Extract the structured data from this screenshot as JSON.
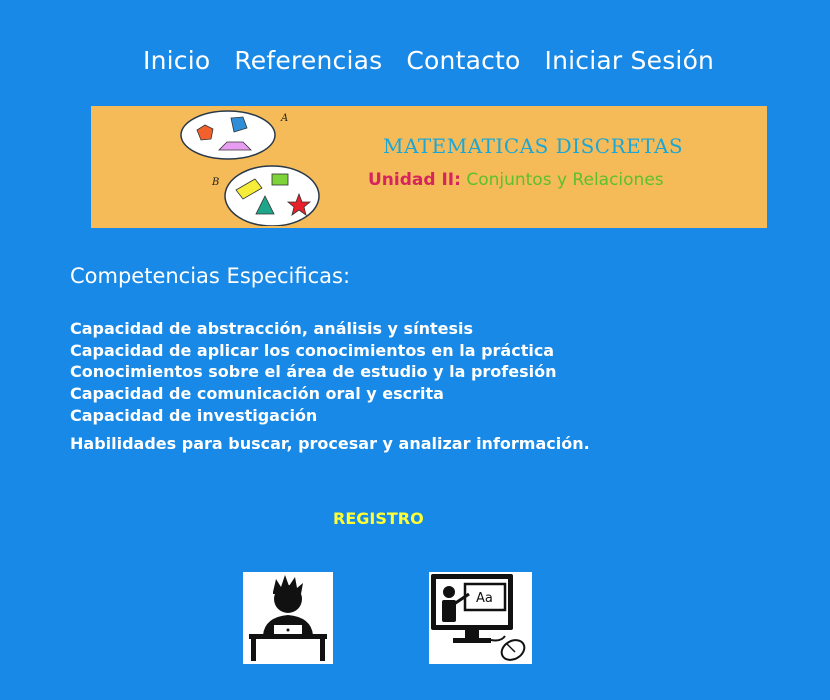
{
  "nav": {
    "items": [
      "Inicio",
      "Referencias",
      "Contacto",
      "Iniciar Sesión"
    ]
  },
  "banner": {
    "title": "MATEMATICAS DISCRETAS",
    "unit": "Unidad II:",
    "topic": "Conjuntos y Relaciones",
    "set_a_label": "A",
    "set_b_label": "B"
  },
  "competencias": {
    "heading": "Competencias Especificas:",
    "items": [
      "Capacidad de abstracción, análisis y síntesis",
      "Capacidad de aplicar los conocimientos en la práctica",
      "Conocimientos sobre el área de estudio y la profesión",
      "Capacidad de comunicación oral y escrita",
      "Capacidad de investigación",
      "Habilidades para buscar, procesar y analizar información."
    ]
  },
  "registro": {
    "label": "REGISTRO",
    "student_icon": "student-laptop-icon",
    "teacher_icon": "teacher-screen-icon",
    "screen_text": "Aa"
  },
  "colors": {
    "background": "#1889e6",
    "banner": "#f6bb59",
    "title": "#1aa7d6",
    "unit": "#d6245e",
    "topic": "#5cc02d",
    "registro": "#ffff33"
  }
}
